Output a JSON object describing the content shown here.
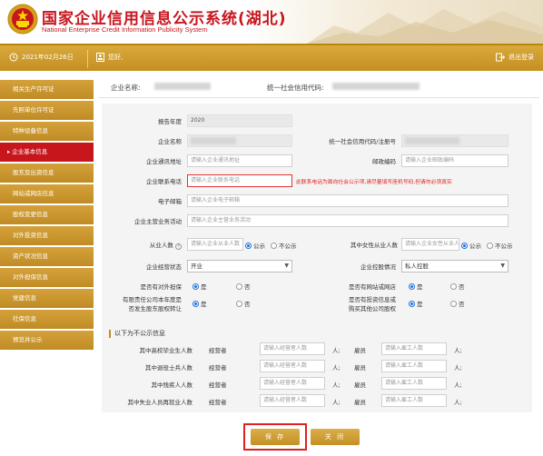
{
  "header": {
    "title": "国家企业信用信息公示系统(湖北)",
    "subtitle": "National Enterprise Credit Information Publicity System"
  },
  "topbar": {
    "date": "2021年02月26日",
    "user_prefix": "您好,",
    "logout": "退出登录"
  },
  "sidebar": {
    "items": [
      {
        "label": "相关生产许可证",
        "active": false
      },
      {
        "label": "先照单位许可证",
        "active": false
      },
      {
        "label": "特种设备信息",
        "active": false
      },
      {
        "label": "企业基本信息",
        "active": true
      },
      {
        "label": "股东及出资信息",
        "active": false
      },
      {
        "label": "网站或网店信息",
        "active": false
      },
      {
        "label": "股权变更信息",
        "active": false
      },
      {
        "label": "对外投资信息",
        "active": false
      },
      {
        "label": "资产状况信息",
        "active": false
      },
      {
        "label": "对外担保信息",
        "active": false
      },
      {
        "label": "党建信息",
        "active": false
      },
      {
        "label": "社保信息",
        "active": false
      },
      {
        "label": "预览并公示",
        "active": false
      }
    ]
  },
  "company": {
    "name_label": "企业名称:",
    "code_label": "统一社会信用代码:"
  },
  "form": {
    "year_label": "报告年度",
    "year_value": "2020",
    "name_label": "企业名称",
    "code_label": "统一社会信用代码/注册号",
    "address_label": "企业通讯地址",
    "address_placeholder": "请输入企业通讯地址",
    "postcode_label": "邮政编码",
    "postcode_placeholder": "请输入企业邮政编码",
    "phone_label": "企业联系电话",
    "phone_placeholder": "请输入企业联系电话",
    "phone_warning": "此联系电话为面向社会公示项,请尽量填写座机号码,但请勿必须真实",
    "email_label": "电子邮箱",
    "email_placeholder": "请输入企业电子邮箱",
    "business_label": "企业主营业务活动",
    "business_placeholder": "请输入企业主营业务活动",
    "employees_label": "从业人数",
    "employees_placeholder": "请输入企业从业人数",
    "public_label": "公示",
    "nonpublic_label": "不公示",
    "female_label": "其中女性从业人数",
    "female_placeholder": "请输入企业女性从业人数",
    "status_label": "企业经营状态",
    "status_value": "开业",
    "holding_label": "企业控股情况",
    "holding_value": "私人控股",
    "guarantee_label": "是否有对外担保",
    "website_label": "是否有网站或网店",
    "equity_label_1": "有限责任公司本年度是",
    "equity_label_2": "否发生股东股权转让",
    "invest_label_1": "是否有投资信息或",
    "invest_label_2": "购买其他公司股权",
    "yes": "是",
    "no": "否"
  },
  "private_section": {
    "title": "以下为不公示信息",
    "rows": [
      {
        "label": "其中高校毕业生人数"
      },
      {
        "label": "其中退役士兵人数"
      },
      {
        "label": "其中残疾人人数"
      },
      {
        "label": "其中失业人员再就业人数"
      }
    ],
    "operator_label": "经营者",
    "operator_placeholder": "请输入经营者人数",
    "employee_label": "雇员",
    "employee_placeholder": "请输入雇工人数",
    "unit": "人;"
  },
  "buttons": {
    "save": "保 存",
    "close": "关 闭"
  },
  "colors": {
    "brand_red": "#c8161d",
    "gold": "#c38f23",
    "warning": "#e02020",
    "radio_blue": "#1e6fd8"
  }
}
